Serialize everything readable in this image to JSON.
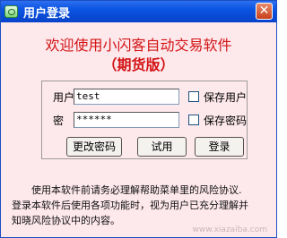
{
  "window": {
    "title": "用户登录"
  },
  "header": {
    "line1": "欢迎使用小闪客自动交易软件",
    "line2": "（期货版）"
  },
  "form": {
    "username_label": "用户名：",
    "username_value": "test",
    "password_label": "密　码：",
    "password_value": "******",
    "remember_user_label": "保存用户",
    "remember_password_label": "保存密码"
  },
  "buttons": {
    "change_password": "更改密码",
    "trial": "试用",
    "login": "登录"
  },
  "notice": {
    "line1": "使用本软件前请务必理解帮助菜单里的风险协议.",
    "line2": "登录本软件后使用各项功能时，视为用户已充分理解并",
    "line3": "知晓风险协议中的内容。"
  },
  "watermark": "www.xiazaiba.com",
  "colors": {
    "titlebar": "#0a53e2",
    "background": "#fde8ec",
    "headline": "#d31415"
  },
  "icons": {
    "app": "app-icon",
    "close": "close-icon"
  }
}
